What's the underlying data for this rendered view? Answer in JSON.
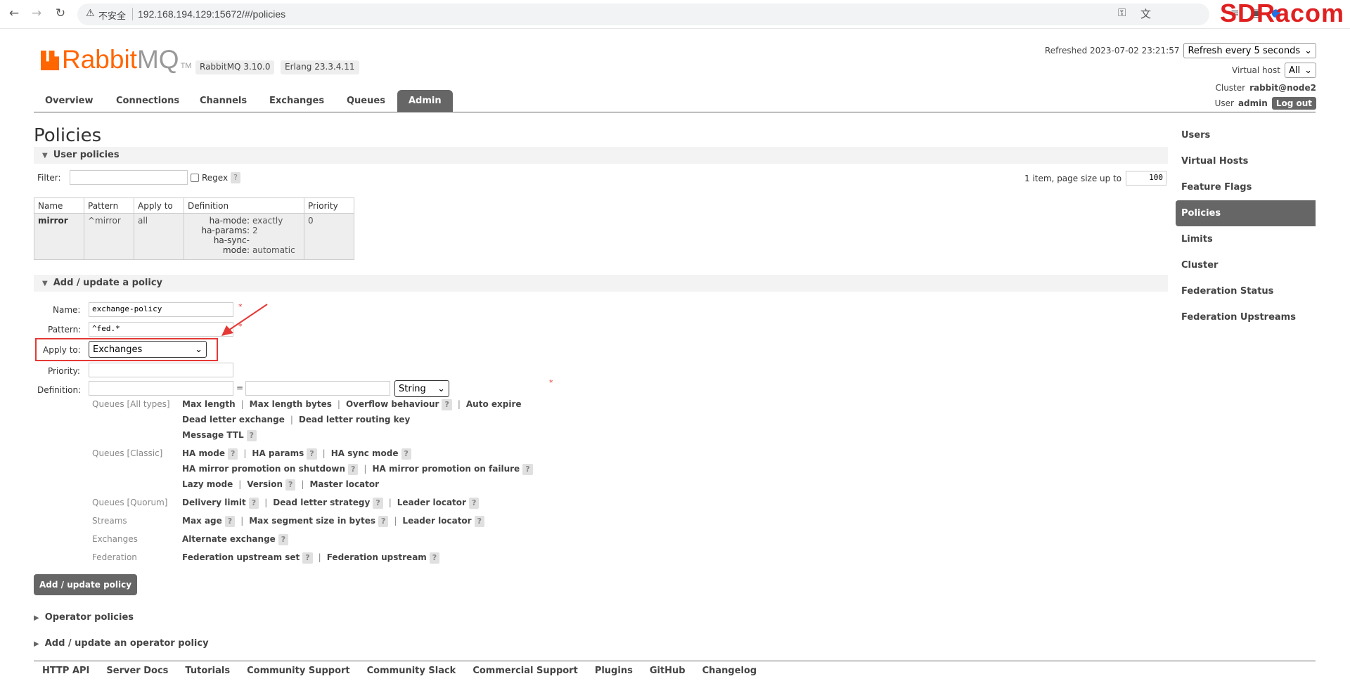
{
  "browser": {
    "insecure_label": "不安全",
    "url": "192.168.194.129:15672/#/policies",
    "corner_text": "SDRacom"
  },
  "header": {
    "logo_rabbit": "Rabbit",
    "logo_mq": "MQ",
    "logo_tm": "TM",
    "version_rabbit": "RabbitMQ 3.10.0",
    "version_erlang": "Erlang 23.3.4.11",
    "refreshed": "Refreshed 2023-07-02 23:21:57",
    "refresh_select": "Refresh every 5 seconds",
    "vhost_label": "Virtual host",
    "vhost_value": "All",
    "cluster_label": "Cluster",
    "cluster_value": "rabbit@node2",
    "user_label": "User",
    "user_value": "admin",
    "logout": "Log out"
  },
  "tabs": [
    "Overview",
    "Connections",
    "Channels",
    "Exchanges",
    "Queues",
    "Admin"
  ],
  "page_title": "Policies",
  "user_policies": {
    "heading": "User policies",
    "filter_label": "Filter:",
    "regex_label": "Regex",
    "help": "?",
    "page_info": "1 item, page size up to",
    "page_size": "100",
    "columns": [
      "Name",
      "Pattern",
      "Apply to",
      "Definition",
      "Priority"
    ],
    "row": {
      "name": "mirror",
      "pattern": "^mirror",
      "apply_to": "all",
      "definition": [
        {
          "key": "ha-mode:",
          "value": "exactly"
        },
        {
          "key": "ha-params:",
          "value": "2"
        },
        {
          "key": "ha-sync-mode:",
          "value": "automatic"
        }
      ],
      "priority": "0"
    }
  },
  "add_policy": {
    "heading": "Add / update a policy",
    "name_label": "Name:",
    "name_value": "exchange-policy",
    "pattern_label": "Pattern:",
    "pattern_value": "^fed.*",
    "apply_label": "Apply to:",
    "apply_value": "Exchanges",
    "priority_label": "Priority:",
    "priority_value": "",
    "definition_label": "Definition:",
    "equals": "=",
    "type_value": "String",
    "required": "*",
    "categories": [
      {
        "cat": "Queues [All types]",
        "lines": [
          [
            "Max length",
            "Max length bytes",
            "Overflow behaviour ?",
            "Auto expire"
          ],
          [
            "Dead letter exchange",
            "Dead letter routing key"
          ],
          [
            "Message TTL ?"
          ]
        ]
      },
      {
        "cat": "Queues [Classic]",
        "lines": [
          [
            "HA mode ?",
            "HA params ?",
            "HA sync mode ?"
          ],
          [
            "HA mirror promotion on shutdown ?",
            "HA mirror promotion on failure ?"
          ],
          [
            "Lazy mode",
            "Version ?",
            "Master locator"
          ]
        ]
      },
      {
        "cat": "Queues [Quorum]",
        "lines": [
          [
            "Delivery limit ?",
            "Dead letter strategy ?",
            "Leader locator ?"
          ]
        ]
      },
      {
        "cat": "Streams",
        "lines": [
          [
            "Max age ?",
            "Max segment size in bytes ?",
            "Leader locator ?"
          ]
        ]
      },
      {
        "cat": "Exchanges",
        "lines": [
          [
            "Alternate exchange ?"
          ]
        ]
      },
      {
        "cat": "Federation",
        "lines": [
          [
            "Federation upstream set ?",
            "Federation upstream ?"
          ]
        ]
      }
    ],
    "submit": "Add / update policy"
  },
  "operator_policies": "Operator policies",
  "add_operator_policy": "Add / update an operator policy",
  "sidebar": [
    "Users",
    "Virtual Hosts",
    "Feature Flags",
    "Policies",
    "Limits",
    "Cluster",
    "Federation Status",
    "Federation Upstreams"
  ],
  "footer": [
    "HTTP API",
    "Server Docs",
    "Tutorials",
    "Community Support",
    "Community Slack",
    "Commercial Support",
    "Plugins",
    "GitHub",
    "Changelog"
  ],
  "colors": {
    "brand": "#ff6600",
    "accent_dark": "#666666",
    "annotation": "#e53935"
  }
}
